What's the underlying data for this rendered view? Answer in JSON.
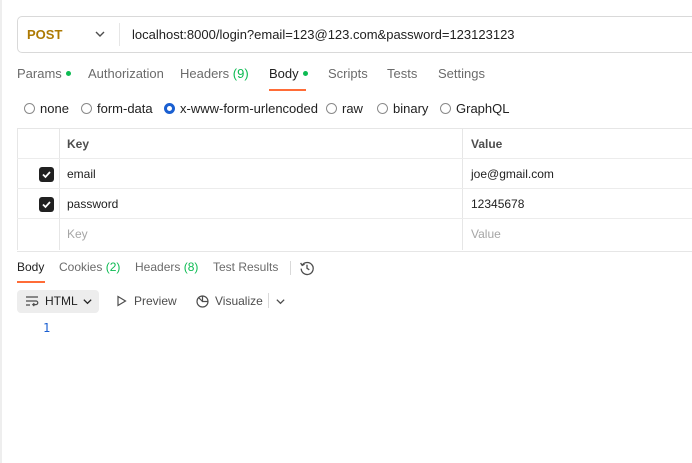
{
  "request": {
    "method": "POST",
    "url": "localhost:8000/login?email=123@123.com&password=123123123"
  },
  "request_tabs": [
    {
      "label": "Params",
      "indicator": "green-dot"
    },
    {
      "label": "Authorization"
    },
    {
      "label": "Headers",
      "count": "(9)"
    },
    {
      "label": "Body",
      "indicator": "green-dot",
      "active": true
    },
    {
      "label": "Scripts"
    },
    {
      "label": "Tests"
    },
    {
      "label": "Settings"
    }
  ],
  "body_types": [
    {
      "label": "none"
    },
    {
      "label": "form-data"
    },
    {
      "label": "x-www-form-urlencoded",
      "selected": true
    },
    {
      "label": "raw"
    },
    {
      "label": "binary"
    },
    {
      "label": "GraphQL"
    }
  ],
  "params_table": {
    "headers": {
      "key": "Key",
      "value": "Value"
    },
    "rows": [
      {
        "checked": true,
        "key": "email",
        "value": "joe@gmail.com"
      },
      {
        "checked": true,
        "key": "password",
        "value": "12345678"
      }
    ],
    "placeholder": {
      "key": "Key",
      "value": "Value"
    }
  },
  "response_tabs": [
    {
      "label": "Body",
      "active": true
    },
    {
      "label": "Cookies",
      "count": "(2)"
    },
    {
      "label": "Headers",
      "count": "(8)"
    },
    {
      "label": "Test Results"
    }
  ],
  "response_toolbar": {
    "format": "HTML",
    "preview": "Preview",
    "visualize": "Visualize"
  },
  "editor": {
    "line_number": "1"
  },
  "colors": {
    "accent": "#ff6c37",
    "method": "#ad7a03",
    "success": "#0cbb52",
    "radio_selected": "#1a5fd1"
  },
  "icons": [
    "chevron-down-icon",
    "history-icon",
    "wrap-icon",
    "play-icon",
    "visualize-icon",
    "checkmark-icon"
  ]
}
